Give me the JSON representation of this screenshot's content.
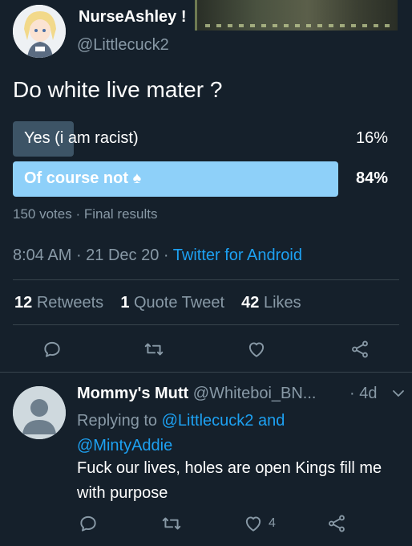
{
  "tweet": {
    "display_name": "NurseAshley !",
    "handle": "@Littlecuck2",
    "text": "Do white live mater ?",
    "poll": {
      "options": [
        {
          "label": "Yes (i am racist)",
          "percent": "16%",
          "fraction": 0.16
        },
        {
          "label": "Of course not ♠",
          "percent": "84%",
          "fraction": 0.84
        }
      ],
      "votes": "150 votes",
      "status": "Final results"
    },
    "time": "8:04 AM",
    "date": "21 Dec 20",
    "source": "Twitter for Android",
    "stats": {
      "retweets_count": "12",
      "retweets_label": "Retweets",
      "quotes_count": "1",
      "quotes_label": "Quote Tweet",
      "likes_count": "42",
      "likes_label": "Likes"
    }
  },
  "reply": {
    "display_name": "Mommy's Mutt",
    "handle": "@Whiteboi_BN...",
    "age": "· 4d",
    "replying_prefix": "Replying to",
    "replying_user1": "@Littlecuck2",
    "replying_and": "and",
    "replying_user2": "@MintyAddie",
    "text": "Fuck our lives, holes are open Kings fill me with purpose",
    "like_count": "4"
  },
  "colors": {
    "background": "#15202b",
    "accent": "#1da1f2",
    "muted": "#8899a6",
    "poll_winner": "#8ed0f9",
    "poll_loser": "#3d5466"
  }
}
